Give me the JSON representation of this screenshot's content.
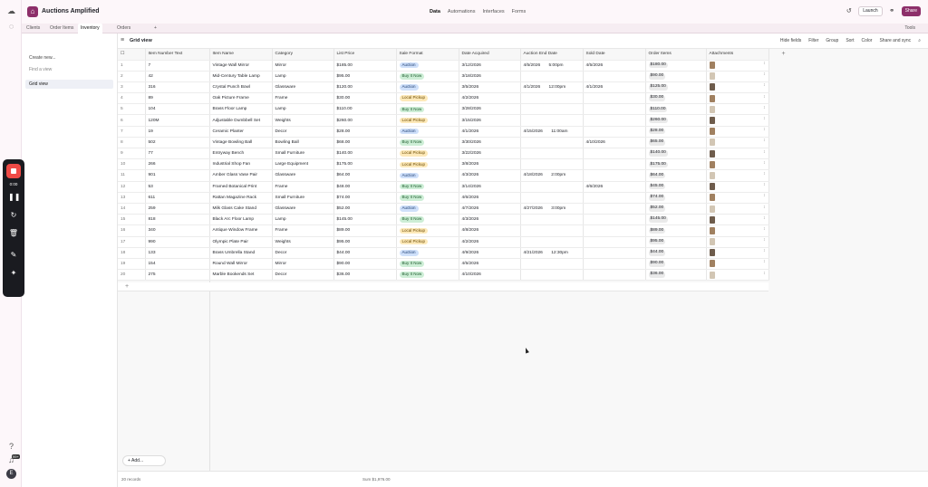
{
  "base": {
    "name": "Auctions Amplified"
  },
  "top_nav": [
    "Data",
    "Automations",
    "Interfaces",
    "Forms"
  ],
  "top_actions": {
    "launch": "Launch",
    "share": "Share"
  },
  "tabs": [
    "Clients",
    "Order Items",
    "Inventory",
    "Orders"
  ],
  "tools_label": "Tools",
  "sidebar": {
    "create_new": "Create new...",
    "find_view": "Find a view",
    "views": [
      "Grid view"
    ]
  },
  "toolbar": {
    "view_name": "Grid view",
    "actions": [
      "Hide fields",
      "Filter",
      "Group",
      "Sort",
      "Color",
      "Share and sync"
    ]
  },
  "columns": [
    "Item Number Text",
    "Item Name",
    "Category",
    "List Price",
    "Sale Format",
    "Date Acquired",
    "Auction End Date",
    "Sold Date",
    "Order Items",
    "Attachments"
  ],
  "rows": [
    {
      "n": "1",
      "num": "7",
      "name": "Vintage Wall Mirror",
      "cat": "Mirror",
      "price": "$185.00",
      "fmt": "Auction",
      "acq": "3/12/2026",
      "end": "4/5/2026",
      "endt": "5:00pm",
      "sold": "4/5/2026",
      "order": "$180.00"
    },
    {
      "n": "2",
      "num": "42",
      "name": "Mid-Century Table Lamp",
      "cat": "Lamp",
      "price": "$95.00",
      "fmt": "Buy It Now",
      "acq": "3/18/2026",
      "end": "",
      "endt": "",
      "sold": "",
      "order": "$90.00"
    },
    {
      "n": "3",
      "num": "316",
      "name": "Crystal Punch Bowl",
      "cat": "Glassware",
      "price": "$120.00",
      "fmt": "Auction",
      "acq": "3/5/2026",
      "end": "4/1/2026",
      "endt": "12:00pm",
      "sold": "4/1/2026",
      "order": "$125.00"
    },
    {
      "n": "4",
      "num": "89",
      "name": "Oak Picture Frame",
      "cat": "Frame",
      "price": "$30.00",
      "fmt": "Local Pickup",
      "acq": "4/2/2026",
      "end": "",
      "endt": "",
      "sold": "",
      "order": "$30.00"
    },
    {
      "n": "5",
      "num": "104",
      "name": "Brass Floor Lamp",
      "cat": "Lamp",
      "price": "$110.00",
      "fmt": "Buy It Now",
      "acq": "3/28/2026",
      "end": "",
      "endt": "",
      "sold": "",
      "order": "$110.00"
    },
    {
      "n": "6",
      "num": "120M",
      "name": "Adjustable Dumbbell Set",
      "cat": "Weights",
      "price": "$260.00",
      "fmt": "Local Pickup",
      "acq": "3/15/2026",
      "end": "",
      "endt": "",
      "sold": "",
      "order": "$260.00"
    },
    {
      "n": "7",
      "num": "19",
      "name": "Ceramic Planter",
      "cat": "Decor",
      "price": "$28.00",
      "fmt": "Auction",
      "acq": "4/1/2026",
      "end": "4/15/2026",
      "endt": "11:00am",
      "sold": "",
      "order": "$28.00"
    },
    {
      "n": "8",
      "num": "502",
      "name": "Vintage Bowling Ball",
      "cat": "Bowling Ball",
      "price": "$68.00",
      "fmt": "Buy It Now",
      "acq": "3/30/2026",
      "end": "",
      "endt": "",
      "sold": "4/10/2026",
      "order": "$65.00"
    },
    {
      "n": "9",
      "num": "77",
      "name": "Entryway Bench",
      "cat": "Small Furniture",
      "price": "$140.00",
      "fmt": "Local Pickup",
      "acq": "3/22/2026",
      "end": "",
      "endt": "",
      "sold": "",
      "order": "$140.00"
    },
    {
      "n": "10",
      "num": "266",
      "name": "Industrial Shop Fan",
      "cat": "Large Equipment",
      "price": "$175.00",
      "fmt": "Local Pickup",
      "acq": "3/8/2026",
      "end": "",
      "endt": "",
      "sold": "",
      "order": "$175.00"
    },
    {
      "n": "11",
      "num": "901",
      "name": "Amber Glass Vase Pair",
      "cat": "Glassware",
      "price": "$64.00",
      "fmt": "Auction",
      "acq": "4/3/2026",
      "end": "4/18/2026",
      "endt": "2:00pm",
      "sold": "",
      "order": "$64.00"
    },
    {
      "n": "12",
      "num": "53",
      "name": "Framed Botanical Print",
      "cat": "Frame",
      "price": "$48.00",
      "fmt": "Buy It Now",
      "acq": "3/14/2026",
      "end": "",
      "endt": "",
      "sold": "4/6/2026",
      "order": "$45.00"
    },
    {
      "n": "13",
      "num": "611",
      "name": "Rattan Magazine Rack",
      "cat": "Small Furniture",
      "price": "$74.00",
      "fmt": "Buy It Now",
      "acq": "4/6/2026",
      "end": "",
      "endt": "",
      "sold": "",
      "order": "$74.00"
    },
    {
      "n": "14",
      "num": "259",
      "name": "Milk Glass Cake Stand",
      "cat": "Glassware",
      "price": "$52.00",
      "fmt": "Auction",
      "acq": "4/7/2026",
      "end": "4/27/2026",
      "endt": "3:00pm",
      "sold": "",
      "order": "$52.00"
    },
    {
      "n": "15",
      "num": "818",
      "name": "Black Arc Floor Lamp",
      "cat": "Lamp",
      "price": "$145.00",
      "fmt": "Buy It Now",
      "acq": "4/3/2026",
      "end": "",
      "endt": "",
      "sold": "",
      "order": "$145.00"
    },
    {
      "n": "16",
      "num": "340",
      "name": "Antique Window Frame",
      "cat": "Frame",
      "price": "$89.00",
      "fmt": "Local Pickup",
      "acq": "4/8/2026",
      "end": "",
      "endt": "",
      "sold": "",
      "order": "$89.00"
    },
    {
      "n": "17",
      "num": "990",
      "name": "Olympic Plate Pair",
      "cat": "Weights",
      "price": "$95.00",
      "fmt": "Local Pickup",
      "acq": "4/2/2026",
      "end": "",
      "endt": "",
      "sold": "",
      "order": "$95.00"
    },
    {
      "n": "18",
      "num": "133",
      "name": "Brass Umbrella Stand",
      "cat": "Decor",
      "price": "$44.00",
      "fmt": "Auction",
      "acq": "4/9/2026",
      "end": "4/21/2026",
      "endt": "12:30pm",
      "sold": "",
      "order": "$44.00"
    },
    {
      "n": "19",
      "num": "154",
      "name": "Round Wall Mirror",
      "cat": "Mirror",
      "price": "$90.00",
      "fmt": "Buy It Now",
      "acq": "4/5/2026",
      "end": "",
      "endt": "",
      "sold": "",
      "order": "$90.00"
    },
    {
      "n": "20",
      "num": "275",
      "name": "Marble Bookends Set",
      "cat": "Decor",
      "price": "$36.00",
      "fmt": "Buy It Now",
      "acq": "4/10/2026",
      "end": "",
      "endt": "",
      "sold": "",
      "order": "$36.00"
    }
  ],
  "footer": {
    "add_label": "Add...",
    "records": "20 records",
    "sum": "Sum $1,976.00"
  },
  "recorder": {
    "time": "0:00"
  },
  "rail_badge": "99+"
}
